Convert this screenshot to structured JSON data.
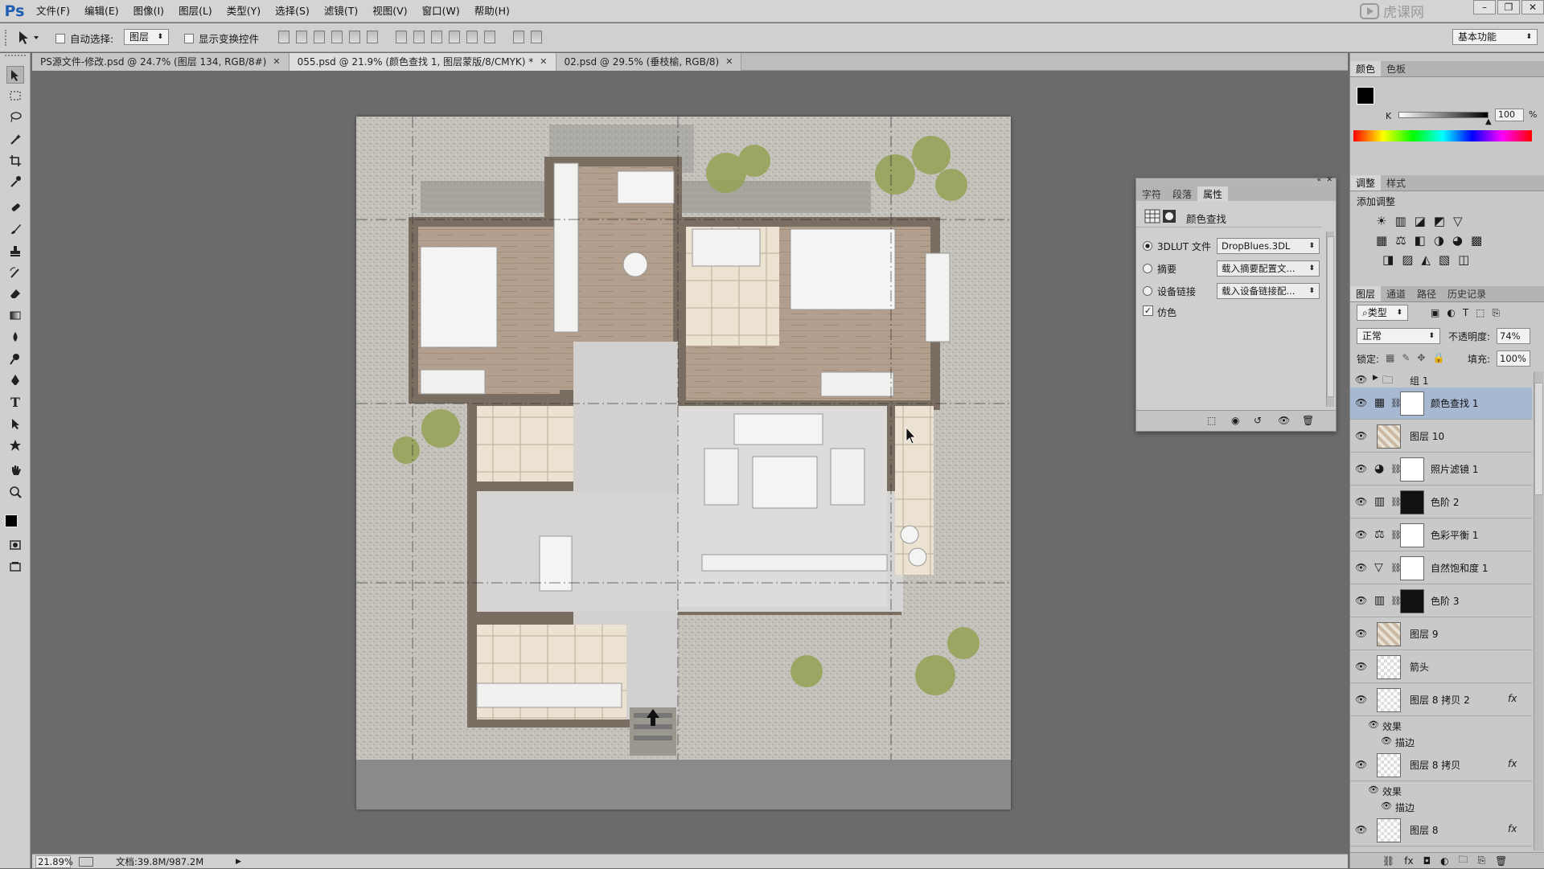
{
  "app": {
    "logo": "Ps"
  },
  "menu": [
    "文件(F)",
    "编辑(E)",
    "图像(I)",
    "图层(L)",
    "类型(Y)",
    "选择(S)",
    "滤镜(T)",
    "视图(V)",
    "窗口(W)",
    "帮助(H)"
  ],
  "window_buttons": {
    "minimize": "–",
    "restore": "❐",
    "close": "✕"
  },
  "options": {
    "auto_select_label": "自动选择:",
    "auto_select_value": "图层",
    "show_transform_label": "显示变换控件",
    "workspace": "基本功能"
  },
  "tabs": [
    {
      "label": "PS源文件-修改.psd @ 24.7% (图层 134, RGB/8#)",
      "active": false
    },
    {
      "label": "055.psd @ 21.9% (颜色查找 1, 图层蒙版/8/CMYK) *",
      "active": true
    },
    {
      "label": "02.psd @ 29.5% (垂枝榆, RGB/8)",
      "active": false
    }
  ],
  "status": {
    "zoom": "21.89%",
    "doc_size": "文档:39.8M/987.2M"
  },
  "color_panel": {
    "tabs": [
      "颜色",
      "色板"
    ],
    "channel": "K",
    "value": "100",
    "unit": "%"
  },
  "adjust_panel": {
    "tabs": [
      "调整",
      "样式"
    ],
    "title": "添加调整"
  },
  "properties": {
    "tabs": [
      "字符",
      "段落",
      "属性"
    ],
    "title": "颜色查找",
    "options": [
      {
        "label": "3DLUT 文件",
        "value": "DropBlues.3DL",
        "selected": true
      },
      {
        "label": "摘要",
        "value": "载入摘要配置文...",
        "selected": false
      },
      {
        "label": "设备链接",
        "value": "载入设备链接配...",
        "selected": false
      }
    ],
    "dither_label": "仿色"
  },
  "layers_panel": {
    "tabs": [
      "图层",
      "通道",
      "路径",
      "历史记录"
    ],
    "filter": "类型",
    "blend_mode": "正常",
    "opacity_label": "不透明度:",
    "opacity": "74%",
    "lock_label": "锁定:",
    "fill_label": "填充:",
    "fill": "100%",
    "group": "组 1",
    "layers": [
      {
        "name": "颜色查找 1",
        "icon": "grid-icon",
        "selected": true
      },
      {
        "name": "图层 10",
        "icon": "plan-thumb"
      },
      {
        "name": "照片滤镜 1",
        "icon": "photo-filter-icon"
      },
      {
        "name": "色阶 2",
        "icon": "levels-icon"
      },
      {
        "name": "色彩平衡 1",
        "icon": "balance-icon"
      },
      {
        "name": "自然饱和度 1",
        "icon": "vibrance-icon"
      },
      {
        "name": "色阶 3",
        "icon": "levels-icon"
      },
      {
        "name": "图层 9",
        "icon": "plan-thumb"
      },
      {
        "name": "箭头",
        "icon": "arrow-thumb"
      }
    ],
    "fx_layers": [
      {
        "name": "图层 8 拷贝 2",
        "effects": "效果",
        "stroke": "描边"
      },
      {
        "name": "图层 8 拷贝",
        "effects": "效果",
        "stroke": "描边"
      },
      {
        "name": "图层 8"
      }
    ],
    "fx_label": "fx"
  }
}
